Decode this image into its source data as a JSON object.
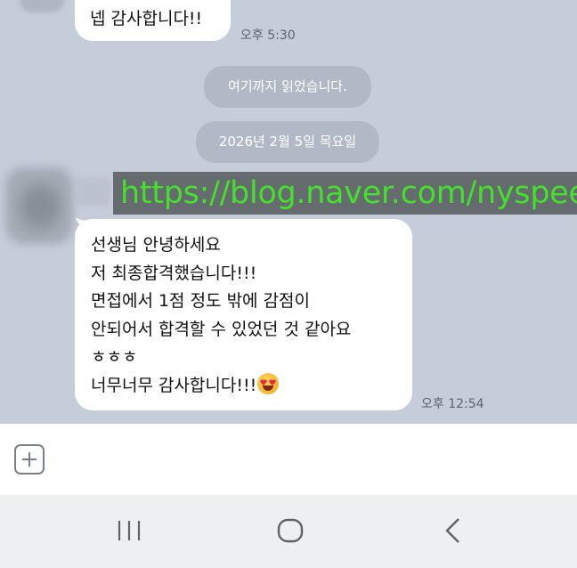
{
  "messages": [
    {
      "text": "넵 감사합니다!!",
      "time": "오후 5:30"
    }
  ],
  "notices": {
    "read_marker": "여기까지 읽었습니다.",
    "date_divider": "2026년 2월 5일 목요일"
  },
  "watermark": "https://blog.naver.com/nyspeech",
  "incoming": {
    "lines": [
      "선생님 안녕하세요",
      "저 최종합격했습니다!!!",
      "면접에서 1점 정도 밖에 감점이",
      "안되어서 합격할 수 있었던 것 같아요",
      "ㅎㅎㅎ",
      "너무너무 감사합니다!!!"
    ],
    "emoji": "heart-eyes-emoji",
    "time": "오후 12:54"
  },
  "icons": {
    "attach": "plus-icon",
    "nav_recent": "recent-apps-icon",
    "nav_home": "home-icon",
    "nav_back": "back-icon"
  },
  "colors": {
    "chat_background": "#c5ccda",
    "bubble": "#ffffff",
    "notice_pill": "#b2b9c6",
    "watermark_text": "#44e02c",
    "watermark_bg": "#656b6f"
  }
}
